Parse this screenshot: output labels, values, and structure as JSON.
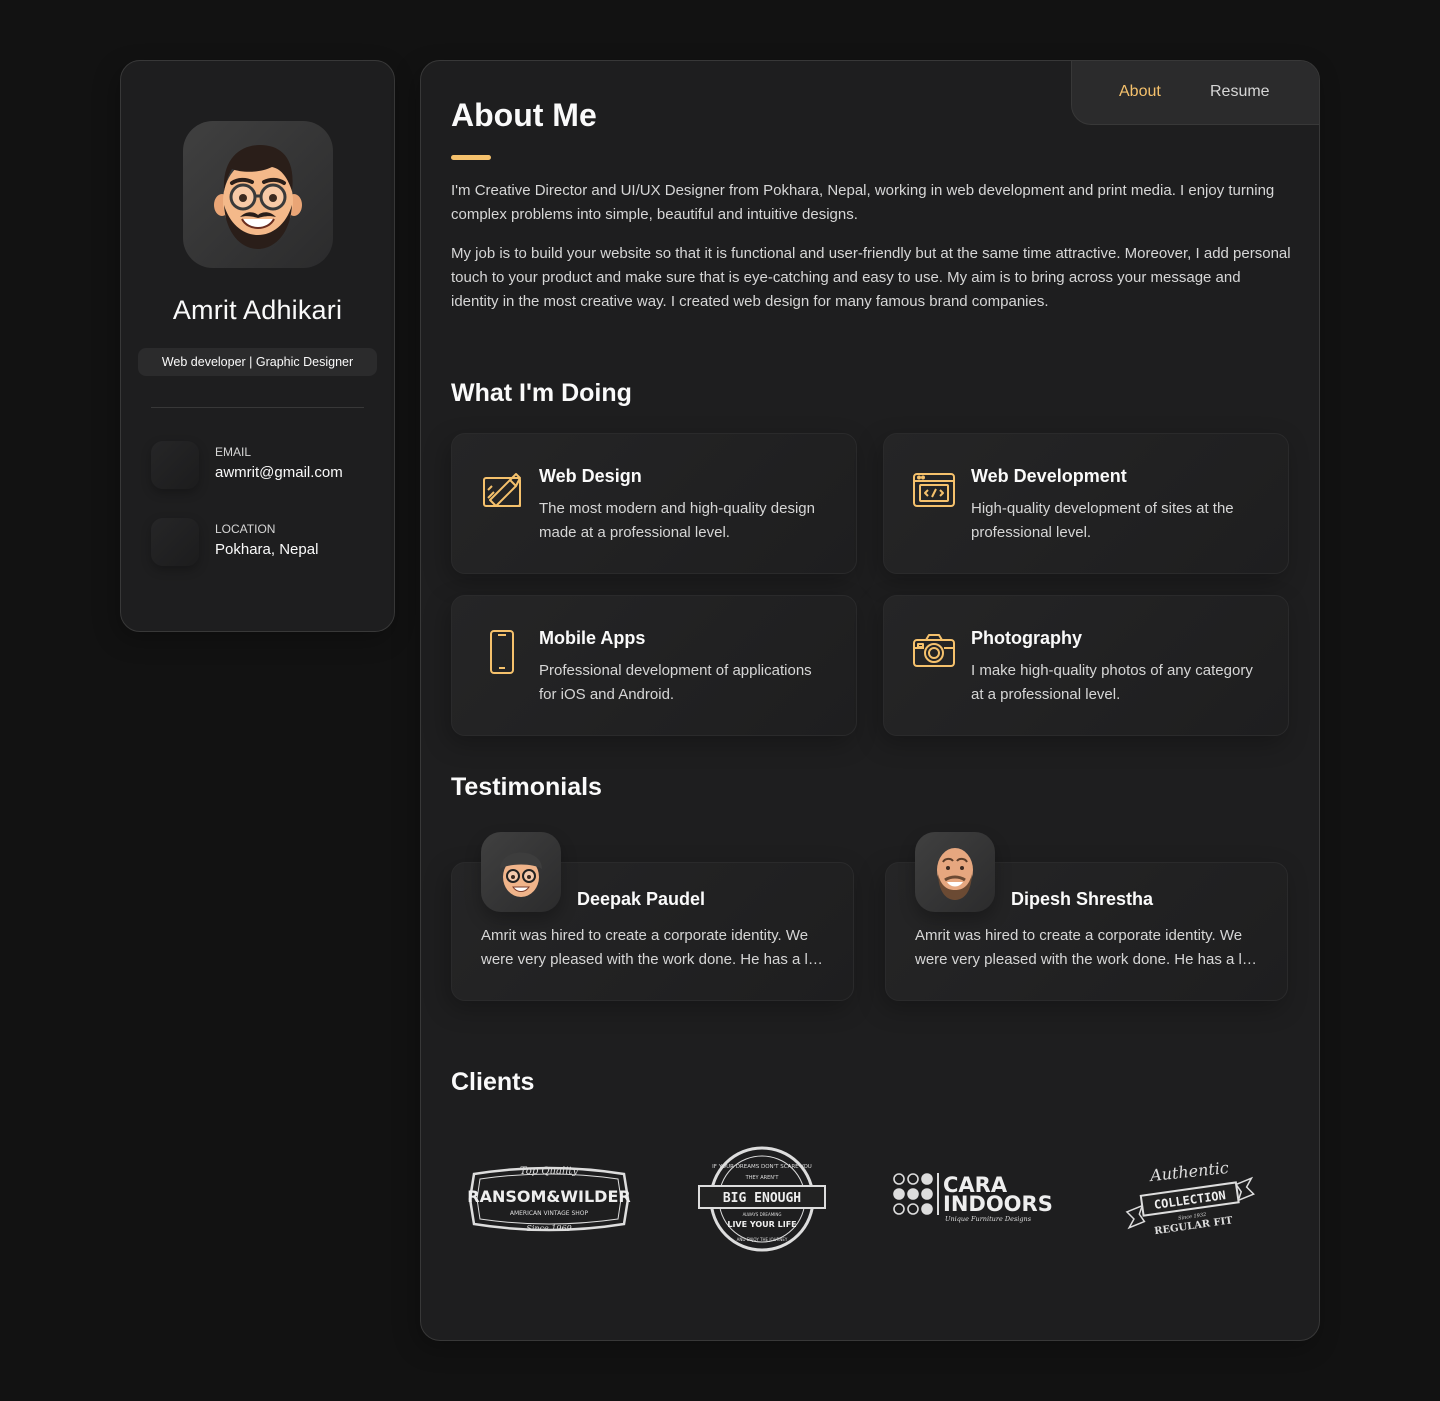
{
  "sidebar": {
    "name": "Amrit Adhikari",
    "title": "Web developer | Graphic Designer",
    "contacts": [
      {
        "label": "EMAIL",
        "value": "awmrit@gmail.com",
        "icon": "mail-icon"
      },
      {
        "label": "LOCATION",
        "value": "Pokhara, Nepal",
        "icon": "location-icon"
      }
    ]
  },
  "navbar": {
    "items": [
      {
        "label": "About",
        "active": true
      },
      {
        "label": "Resume",
        "active": false
      }
    ]
  },
  "about": {
    "title": "About Me",
    "paragraphs": [
      "I'm Creative Director and UI/UX Designer from Pokhara, Nepal, working in web development and print media. I enjoy turning complex problems into simple, beautiful and intuitive designs.",
      "My job is to build your website so that it is functional and user-friendly but at the same time attractive. Moreover, I add personal touch to your product and make sure that is eye-catching and easy to use. My aim is to bring across your message and identity in the most creative way. I created web design for many famous brand companies."
    ]
  },
  "services": {
    "title": "What I'm Doing",
    "items": [
      {
        "title": "Web Design",
        "text": "The most modern and high-quality design made at a professional level.",
        "icon": "design-icon"
      },
      {
        "title": "Web Development",
        "text": "High-quality development of sites at the professional level.",
        "icon": "code-icon"
      },
      {
        "title": "Mobile Apps",
        "text": "Professional development of applications for iOS and Android.",
        "icon": "mobile-icon"
      },
      {
        "title": "Photography",
        "text": "I make high-quality photos of any category at a professional level.",
        "icon": "camera-icon"
      }
    ]
  },
  "testimonials": {
    "title": "Testimonials",
    "items": [
      {
        "name": "Deepak Paudel",
        "text": "Amrit was hired to create a corporate identity. We were very pleased with the work done. He has a lot of experience and is very concerned about the needs of client."
      },
      {
        "name": "Dipesh Shrestha",
        "text": "Amrit was hired to create a corporate identity. We were very pleased with the work done. He has a lot of experience and is very concerned about the needs of client."
      }
    ]
  },
  "clients": {
    "title": "Clients",
    "logos": [
      {
        "lines": [
          "Top Quality",
          "RANSOM&WILDER",
          "AMERICAN VINTAGE SHOP",
          "Since 1969"
        ]
      },
      {
        "lines": [
          "IF YOUR DREAMS DON'T SCARE YOU",
          "THEY AREN'T",
          "BIG ENOUGH",
          "ALWAYS DREAMING",
          "LIVE YOUR LIFE",
          "AND ENJOY THE JOURNEY"
        ]
      },
      {
        "lines": [
          "CARA",
          "INDOORS",
          "Unique Furniture Designs"
        ]
      },
      {
        "lines": [
          "Authentic",
          "COLLECTION",
          "Since 1932",
          "REGULAR FIT"
        ]
      }
    ]
  },
  "colors": {
    "accent": "#f5c16c",
    "background": "#121212",
    "card": "#1e1e1f",
    "text_light": "#d6d6d6"
  }
}
